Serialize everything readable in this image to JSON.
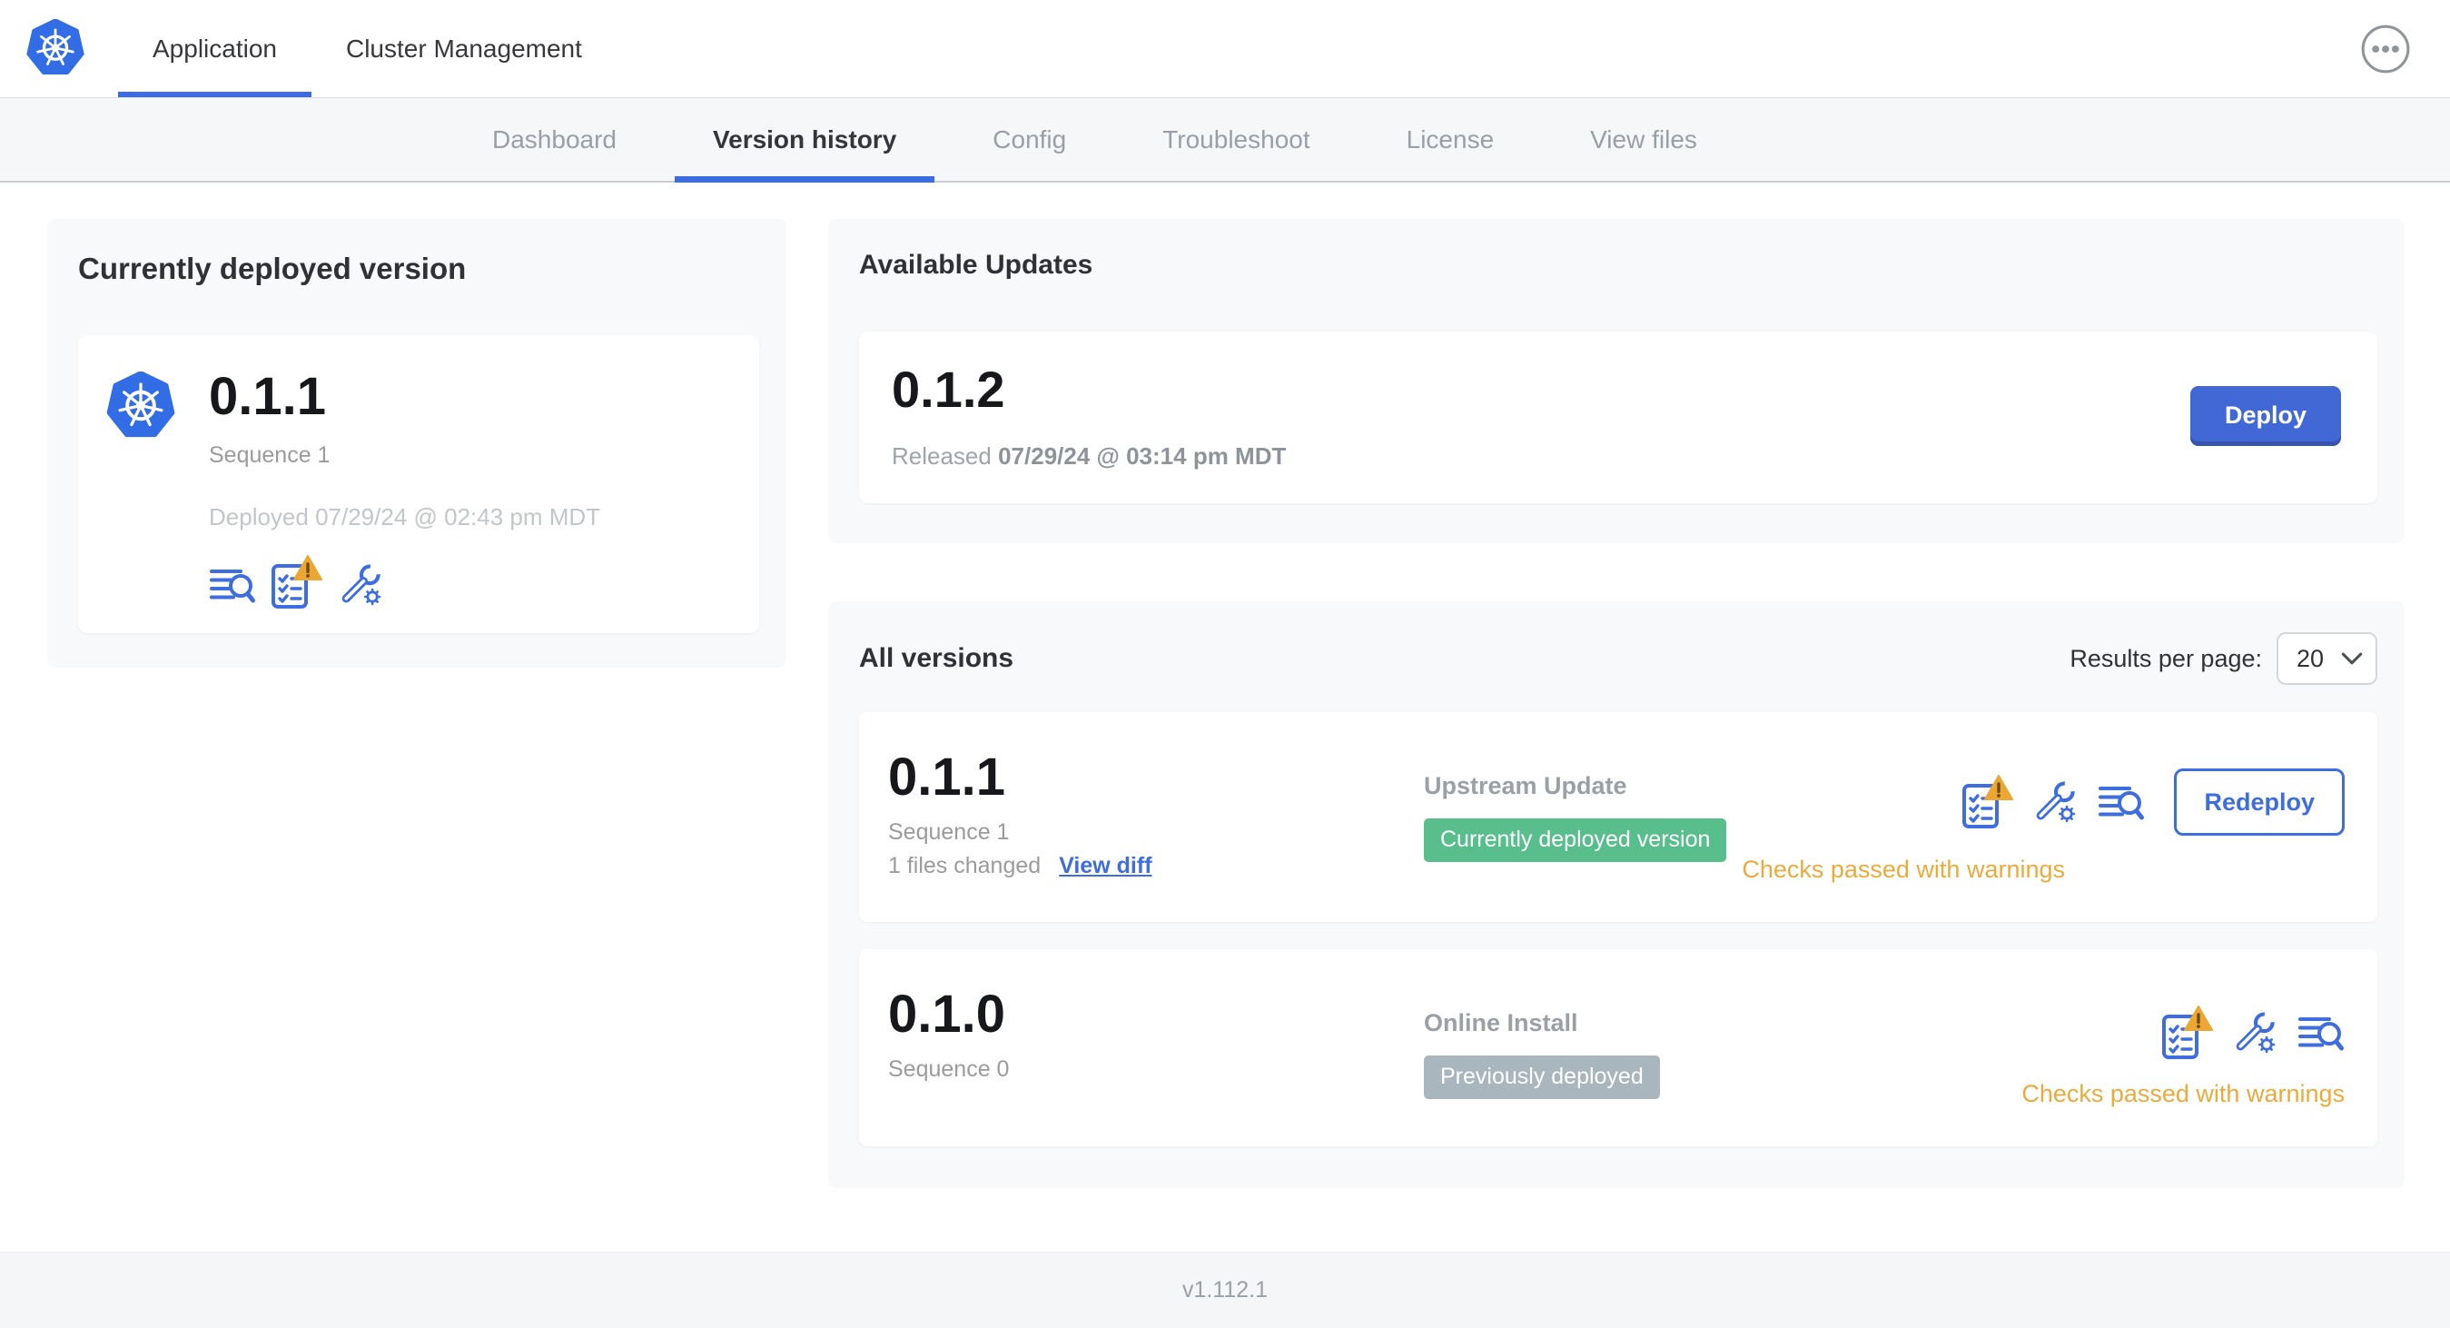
{
  "header": {
    "tabs": [
      {
        "label": "Application",
        "active": true
      },
      {
        "label": "Cluster Management",
        "active": false
      }
    ]
  },
  "nav": {
    "tabs": [
      {
        "label": "Dashboard",
        "active": false
      },
      {
        "label": "Version history",
        "active": true
      },
      {
        "label": "Config",
        "active": false
      },
      {
        "label": "Troubleshoot",
        "active": false
      },
      {
        "label": "License",
        "active": false
      },
      {
        "label": "View files",
        "active": false
      }
    ]
  },
  "current_version_card": {
    "title": "Currently deployed version",
    "version": "0.1.1",
    "sequence": "Sequence 1",
    "deployed": "Deployed 07/29/24 @ 02:43 pm MDT",
    "icons": [
      "view-files-icon",
      "preflight-checks-warning-icon",
      "config-icon"
    ]
  },
  "available_updates": {
    "title": "Available Updates",
    "version": "0.1.2",
    "released_prefix": "Released",
    "released_date": "07/29/24 @ 03:14 pm MDT",
    "deploy_label": "Deploy"
  },
  "all_versions": {
    "title": "All versions",
    "results_per_page_label": "Results per page:",
    "results_per_page_value": "20",
    "rows": [
      {
        "version": "0.1.1",
        "sequence": "Sequence 1",
        "files_changed": "1 files changed",
        "view_diff_label": "View diff",
        "source": "Upstream Update",
        "badge": {
          "label": "Currently deployed version",
          "color": "#57be8c"
        },
        "status": "Checks passed with warnings",
        "action_label": "Redeploy",
        "icons": [
          "preflight-checks-warning-icon",
          "config-icon",
          "view-files-icon"
        ]
      },
      {
        "version": "0.1.0",
        "sequence": "Sequence 0",
        "source": "Online Install",
        "badge": {
          "label": "Previously deployed",
          "color": "#a9b6be"
        },
        "status": "Checks passed with warnings",
        "icons": [
          "preflight-checks-warning-icon",
          "config-icon",
          "view-files-icon"
        ]
      }
    ]
  },
  "footer": {
    "version": "v1.112.1"
  },
  "colors": {
    "brand_blue": "#326de6",
    "accent_blue": "#3e6de0",
    "success_green": "#57be8c",
    "muted_gray_badge": "#a9b6be",
    "warning_amber": "#ebab3c",
    "deploy_button_bg": "#4268d6"
  }
}
